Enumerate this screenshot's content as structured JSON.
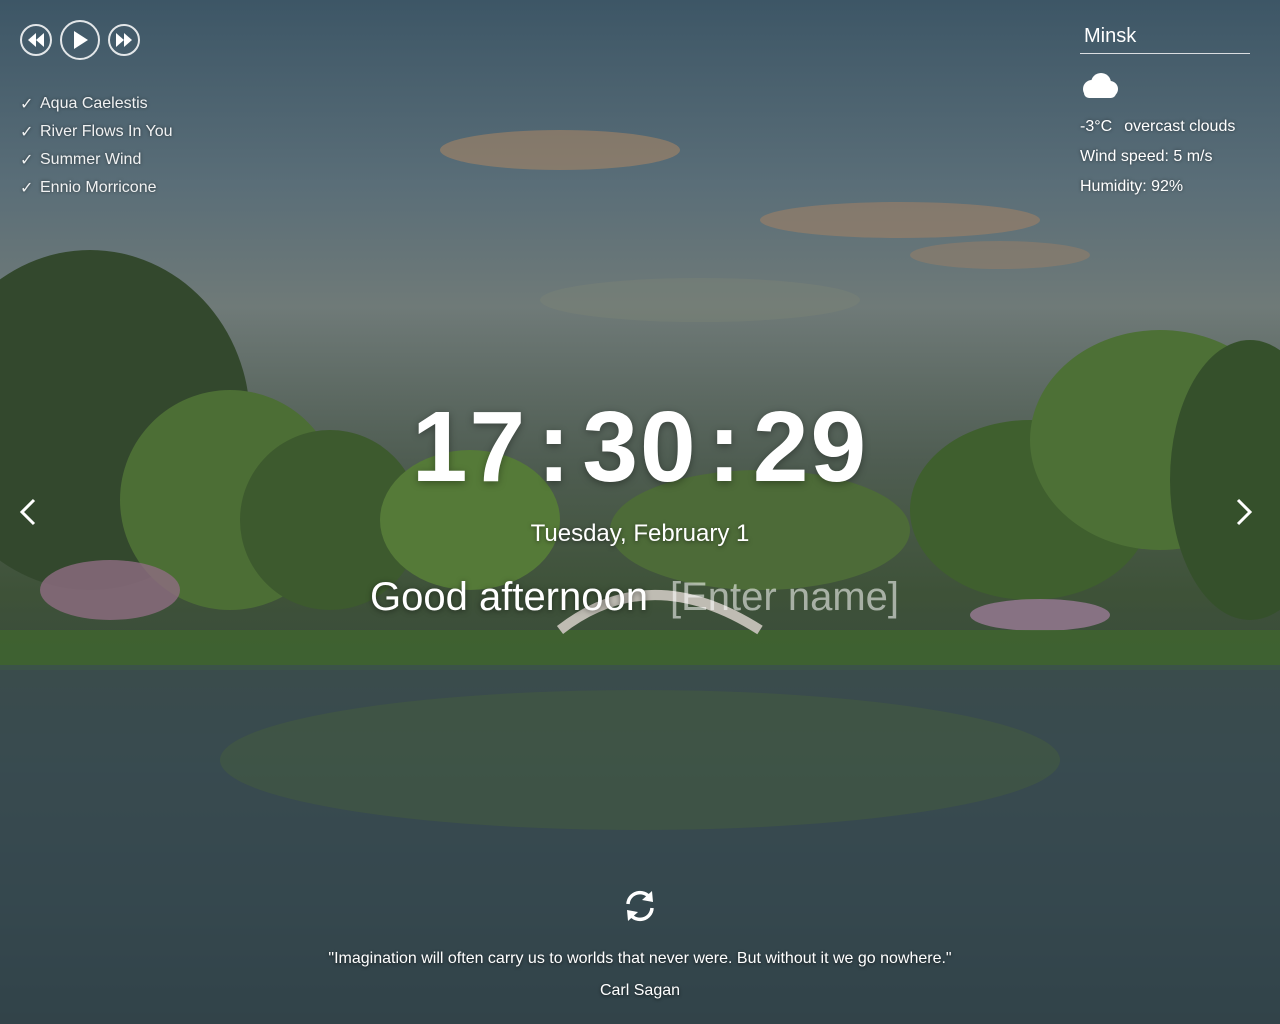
{
  "player": {
    "tracks": [
      {
        "title": "Aqua Caelestis"
      },
      {
        "title": "River Flows In You"
      },
      {
        "title": "Summer Wind"
      },
      {
        "title": "Ennio Morricone"
      }
    ],
    "check_glyph": "✓"
  },
  "weather": {
    "city": "Minsk",
    "icon": "cloud-icon",
    "temperature": "-3°C",
    "description": "overcast clouds",
    "wind": "Wind speed: 5 m/s",
    "humidity": "Humidity: 92%"
  },
  "clock": {
    "hours": "17",
    "minutes": "30",
    "seconds": "29",
    "separator": ":"
  },
  "date": "Tuesday, February 1",
  "greeting": {
    "text": "Good afternoon",
    "name_placeholder": "[Enter name]"
  },
  "quote": {
    "text": "\"Imagination will often carry us to worlds that never were. But without it we go nowhere.\"",
    "author": "Carl Sagan"
  },
  "colors": {
    "text": "#ffffff"
  }
}
